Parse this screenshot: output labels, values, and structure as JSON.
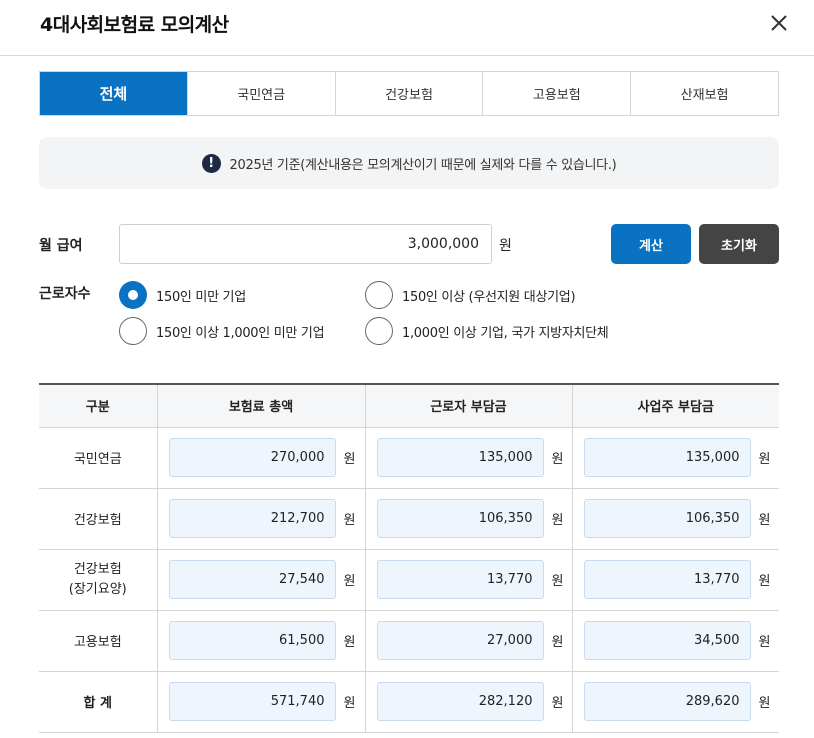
{
  "header": {
    "title": "4대사회보험료 모의계산"
  },
  "tabs": [
    "전체",
    "국민연금",
    "건강보험",
    "고용보험",
    "산재보험"
  ],
  "notice": {
    "icon": "exclamation-icon",
    "text": "2025년 기준(계산내용은 모의계산이기 때문에 실제와 다를 수 있습니다.)"
  },
  "salary": {
    "label": "월 급여",
    "value": "3,000,000",
    "unit": "원"
  },
  "buttons": {
    "calc": "계산",
    "reset": "초기화"
  },
  "workers": {
    "label": "근로자수",
    "options": [
      {
        "label": "150인 미만 기업",
        "checked": true
      },
      {
        "label": "150인 이상 (우선지원 대상기업)",
        "checked": false
      },
      {
        "label": "150인 이상 1,000인 미만 기업",
        "checked": false
      },
      {
        "label": "1,000인 이상 기업, 국가 지방자치단체",
        "checked": false
      }
    ]
  },
  "table": {
    "headers": [
      "구분",
      "보험료 총액",
      "근로자 부담금",
      "사업주 부담금"
    ],
    "unit": "원",
    "rows": [
      {
        "label": "국민연금",
        "label2": "",
        "values": [
          "270,000",
          "135,000",
          "135,000"
        ]
      },
      {
        "label": "건강보험",
        "label2": "",
        "values": [
          "212,700",
          "106,350",
          "106,350"
        ]
      },
      {
        "label": "건강보험",
        "label2": "(장기요양)",
        "values": [
          "27,540",
          "13,770",
          "13,770"
        ]
      },
      {
        "label": "고용보험",
        "label2": "",
        "values": [
          "61,500",
          "27,000",
          "34,500"
        ]
      },
      {
        "label": "합 계",
        "label2": "",
        "values": [
          "571,740",
          "282,120",
          "289,620"
        ]
      }
    ]
  },
  "colors": {
    "primary": "#0a72c2",
    "dark_button": "#444444",
    "amount_bg": "#eef5fd"
  }
}
